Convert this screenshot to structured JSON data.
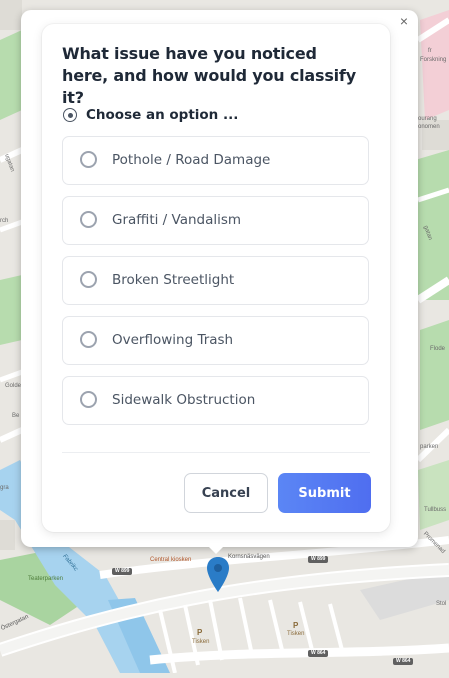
{
  "popup": {
    "close_symbol": "×",
    "question": "What issue have you noticed here, and how would you classify it?",
    "prompt": "Choose an option ...",
    "options": [
      {
        "label": "Pothole / Road Damage"
      },
      {
        "label": "Graffiti / Vandalism"
      },
      {
        "label": "Broken Streetlight"
      },
      {
        "label": "Overflowing Trash"
      },
      {
        "label": "Sidewalk Obstruction"
      }
    ],
    "cancel_label": "Cancel",
    "submit_label": "Submit"
  },
  "map": {
    "street_kornsno": "Kornsnäsvägen",
    "poi_central": "Central kiosken",
    "park_teater": "Teaterparken",
    "water_fabrik": "Fabrikc",
    "street_ostergatan": "Östergatan",
    "road_w899": "W 899",
    "road_w899b": "W 899",
    "road_w864": "W 864",
    "road_w864b": "W 864",
    "parking_sign": "P",
    "parking_label": "Tisken",
    "parking_label_b": "Tisken",
    "label_forskning": "Forskning",
    "label_fr": "fr",
    "label_oursong": "ourang",
    "label_ononomen": "onomen",
    "label_floder": "Flode",
    "label_parken": "parken",
    "label_tullbus": "Tullbuss",
    "label_promenad": "Promenad",
    "label_stol": "Stol",
    "label_gata": "gatan",
    "label_uppsala": "ugatan",
    "label_golden": "Golde",
    "label_be": "Be",
    "label_rch": "rch",
    "label_gra": "gra"
  },
  "colors": {
    "accent": "#4f6ef0",
    "map_bg": "#e9e7e2",
    "park": "#a9d4a0",
    "water": "#a7d3ef",
    "pin": "#2a7cc7"
  },
  "icons": {
    "close": "close-icon",
    "choose": "radio-target-icon",
    "pin": "map-pin-icon"
  }
}
